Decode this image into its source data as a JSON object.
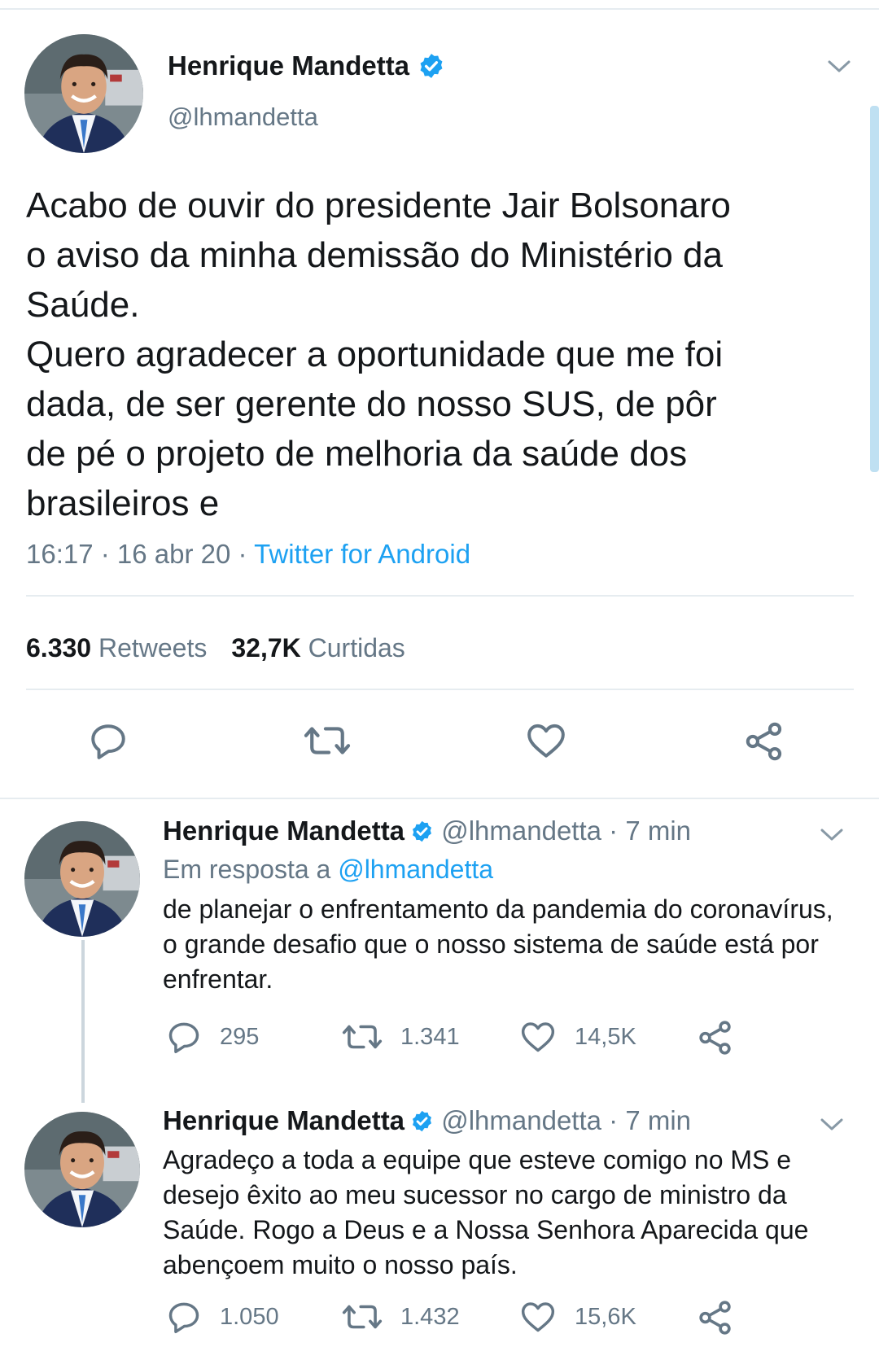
{
  "main_tweet": {
    "author_name": "Henrique Mandetta",
    "handle": "@lhmandetta",
    "text": "Acabo de ouvir do presidente Jair Bolsonaro\no aviso da minha demissão do Ministério da\nSaúde.\nQuero agradecer a oportunidade que me foi\ndada, de ser gerente do nosso SUS, de pôr\nde pé o projeto de melhoria da saúde dos\nbrasileiros e",
    "timestamp": "16:17 · 16 abr 20 · ",
    "source": "Twitter for Android",
    "retweets_count": "6.330",
    "retweets_label": "Retweets",
    "likes_count": "32,7K",
    "likes_label": "Curtidas"
  },
  "replies": [
    {
      "author_name": "Henrique Mandetta",
      "handle": "@lhmandetta",
      "time": " · 7 min",
      "reply_to_prefix": "Em resposta a ",
      "reply_to_handle": "@lhmandetta",
      "text": "de planejar o enfrentamento da pandemia do coronavírus,\no grande desafio que o nosso sistema de saúde está por\nenfrentar.",
      "replies_count": "295",
      "retweets_count": "1.341",
      "likes_count": "14,5K"
    },
    {
      "author_name": "Henrique Mandetta",
      "handle": "@lhmandetta",
      "time": " · 7 min",
      "text": "Agradeço a toda a equipe que esteve comigo no MS e\ndesejo êxito ao meu sucessor no cargo de ministro da\nSaúde. Rogo a Deus e a Nossa Senhora Aparecida que\nabençoem muito o nosso país.",
      "replies_count": "1.050",
      "retweets_count": "1.432",
      "likes_count": "15,6K"
    }
  ],
  "colors": {
    "accent": "#1da1f2",
    "text_primary": "#14171a",
    "text_secondary": "#657786",
    "divider": "#e6ecf0"
  },
  "icons": [
    "verified-badge-icon",
    "chevron-down-icon",
    "reply-icon",
    "retweet-icon",
    "like-icon",
    "share-icon"
  ]
}
